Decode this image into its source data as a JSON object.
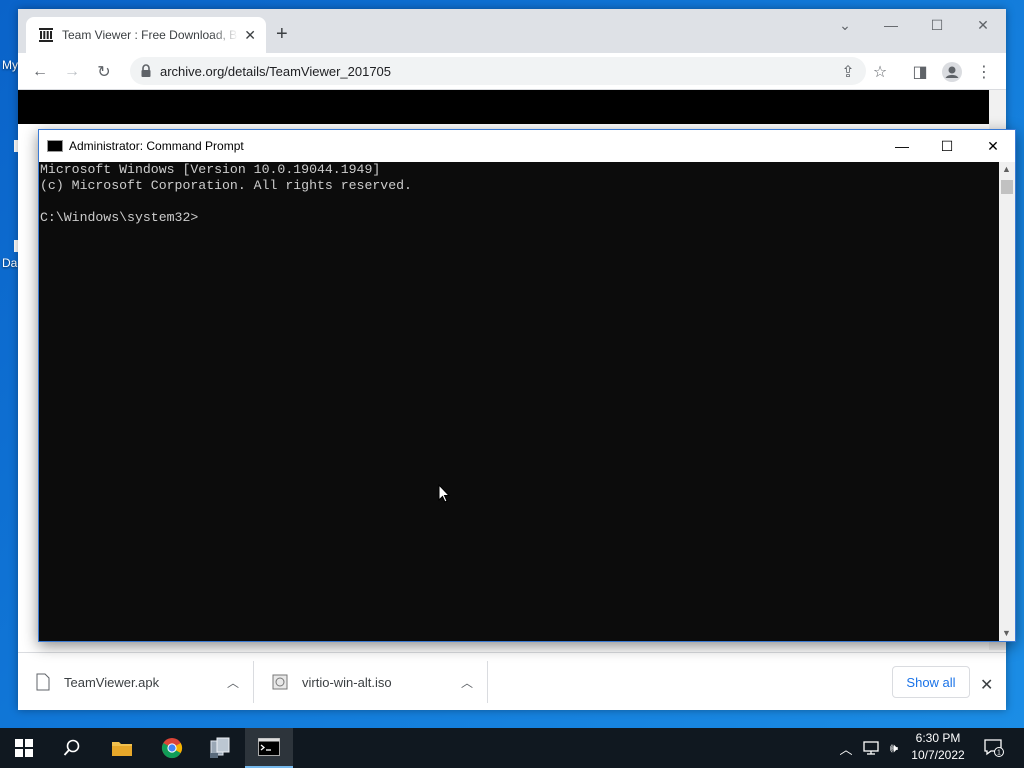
{
  "desktop": {
    "icon_label_1": "My",
    "icon_label_2": "Da"
  },
  "browser": {
    "tab_title": "Team Viewer : Free Download, Borrow, and Streaming : Internet Archive",
    "url": "archive.org/details/TeamViewer_201705",
    "downloads": [
      {
        "name": "TeamViewer.apk",
        "icon": "file-icon"
      },
      {
        "name": "virtio-win-alt.iso",
        "icon": "iso-file-icon"
      }
    ],
    "show_all_label": "Show all"
  },
  "cmd": {
    "title": "Administrator: Command Prompt",
    "output": "Microsoft Windows [Version 10.0.19044.1949]\n(c) Microsoft Corporation. All rights reserved.\n\nC:\\Windows\\system32>"
  },
  "taskbar": {
    "time": "6:30 PM",
    "date": "10/7/2022",
    "notification_count": "1",
    "items": [
      "start-icon",
      "search-icon",
      "file-explorer-icon",
      "chrome-icon",
      "network-app-icon",
      "command-prompt-icon"
    ]
  },
  "colors": {
    "desktop": "#0a63c9",
    "console_bg": "#0c0c0c",
    "console_text": "#cccccc",
    "link_blue": "#1a73e8",
    "taskbar": "#101820"
  }
}
